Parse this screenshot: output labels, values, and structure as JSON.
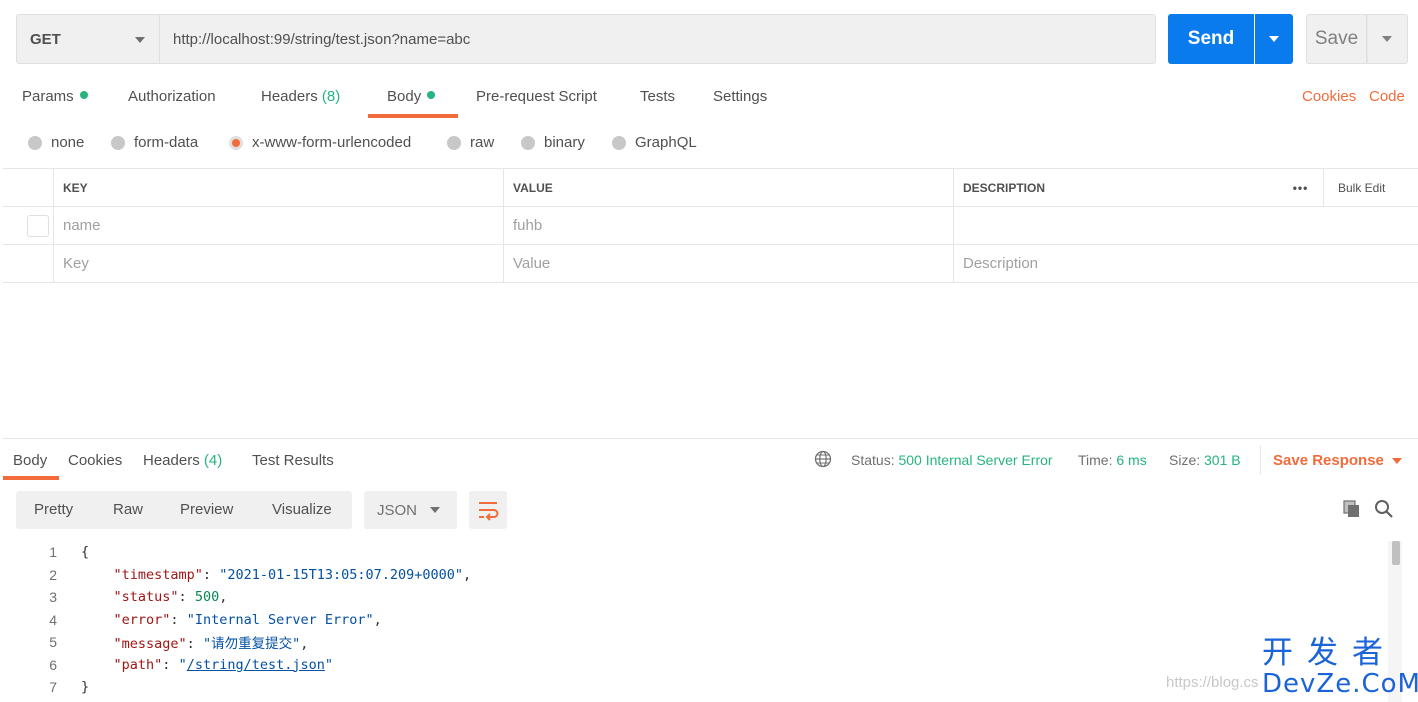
{
  "request": {
    "method": "GET",
    "url": "http://localhost:99/string/test.json?name=abc",
    "send_label": "Send",
    "save_label": "Save"
  },
  "request_tabs": [
    {
      "label": "Params",
      "active": false,
      "dot": true
    },
    {
      "label": "Authorization",
      "active": false
    },
    {
      "label": "Headers",
      "count": "(8)",
      "active": false
    },
    {
      "label": "Body",
      "active": true,
      "dot": true
    },
    {
      "label": "Pre-request Script",
      "active": false
    },
    {
      "label": "Tests",
      "active": false
    },
    {
      "label": "Settings",
      "active": false
    }
  ],
  "request_links": {
    "cookies": "Cookies",
    "code": "Code"
  },
  "body_types": [
    {
      "label": "none",
      "selected": false
    },
    {
      "label": "form-data",
      "selected": false
    },
    {
      "label": "x-www-form-urlencoded",
      "selected": true
    },
    {
      "label": "raw",
      "selected": false
    },
    {
      "label": "binary",
      "selected": false
    },
    {
      "label": "GraphQL",
      "selected": false
    }
  ],
  "params_table": {
    "headers": {
      "key": "KEY",
      "value": "VALUE",
      "description": "DESCRIPTION",
      "more": "•••",
      "bulk_edit": "Bulk Edit"
    },
    "rows": [
      {
        "key": "name",
        "value": "fuhb",
        "description": ""
      }
    ],
    "placeholders": {
      "key": "Key",
      "value": "Value",
      "description": "Description"
    }
  },
  "response_tabs": [
    {
      "label": "Body",
      "active": true
    },
    {
      "label": "Cookies",
      "active": false
    },
    {
      "label": "Headers",
      "count": "(4)",
      "active": false
    },
    {
      "label": "Test Results",
      "active": false
    }
  ],
  "response_meta": {
    "status_label": "Status:",
    "status_value": "500 Internal Server Error",
    "time_label": "Time:",
    "time_value": "6 ms",
    "size_label": "Size:",
    "size_value": "301 B",
    "save_response": "Save Response"
  },
  "view_modes": [
    "Pretty",
    "Raw",
    "Preview",
    "Visualize"
  ],
  "format": "JSON",
  "code_lines": [
    {
      "n": "1"
    },
    {
      "n": "2"
    },
    {
      "n": "3"
    },
    {
      "n": "4"
    },
    {
      "n": "5"
    },
    {
      "n": "6"
    },
    {
      "n": "7"
    }
  ],
  "response_json": {
    "open": "{",
    "timestamp_key": "\"timestamp\"",
    "timestamp_val": "\"2021-01-15T13:05:07.209+0000\"",
    "status_key": "\"status\"",
    "status_val": "500",
    "error_key": "\"error\"",
    "error_val": "\"Internal Server Error\"",
    "message_key": "\"message\"",
    "message_val": "\"请勿重复提交\"",
    "path_key": "\"path\"",
    "path_val": "/string/test.json",
    "close": "}"
  },
  "watermark": {
    "url": "https://blog.cs",
    "logo_cn": "开发者",
    "logo_en": "DevZe.CoM"
  },
  "colors": {
    "accent": "#f26b3a",
    "send": "#097bed",
    "success": "#26b47f",
    "watermark": "#1a63d8"
  }
}
